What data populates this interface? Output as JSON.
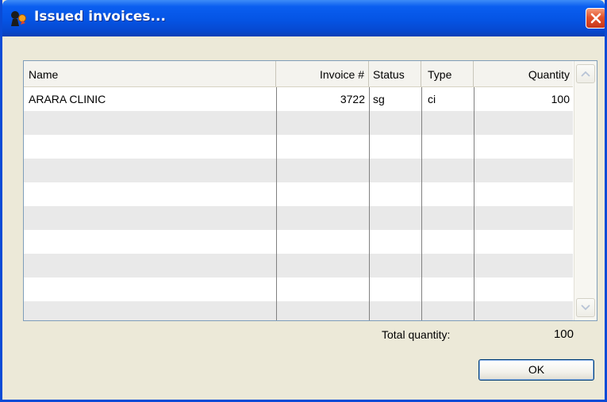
{
  "window": {
    "title": "Issued invoices...",
    "icon": "app-icon",
    "close_icon": "close-icon"
  },
  "table": {
    "columns": [
      "Name",
      "Invoice #",
      "Status",
      "Type",
      "Quantity"
    ],
    "rows": [
      {
        "name": "ARARA CLINIC",
        "invoice": "3722",
        "status": "sg",
        "type": "ci",
        "quantity": "100"
      }
    ],
    "empty_rows": 9
  },
  "footer": {
    "total_label": "Total quantity:",
    "total_value": "100",
    "ok_label": "OK"
  },
  "colors": {
    "titlebar": "#0554e4",
    "window_bg": "#ece9d8",
    "row_alt": "#e9e9e9",
    "close_button": "#e3522b"
  }
}
